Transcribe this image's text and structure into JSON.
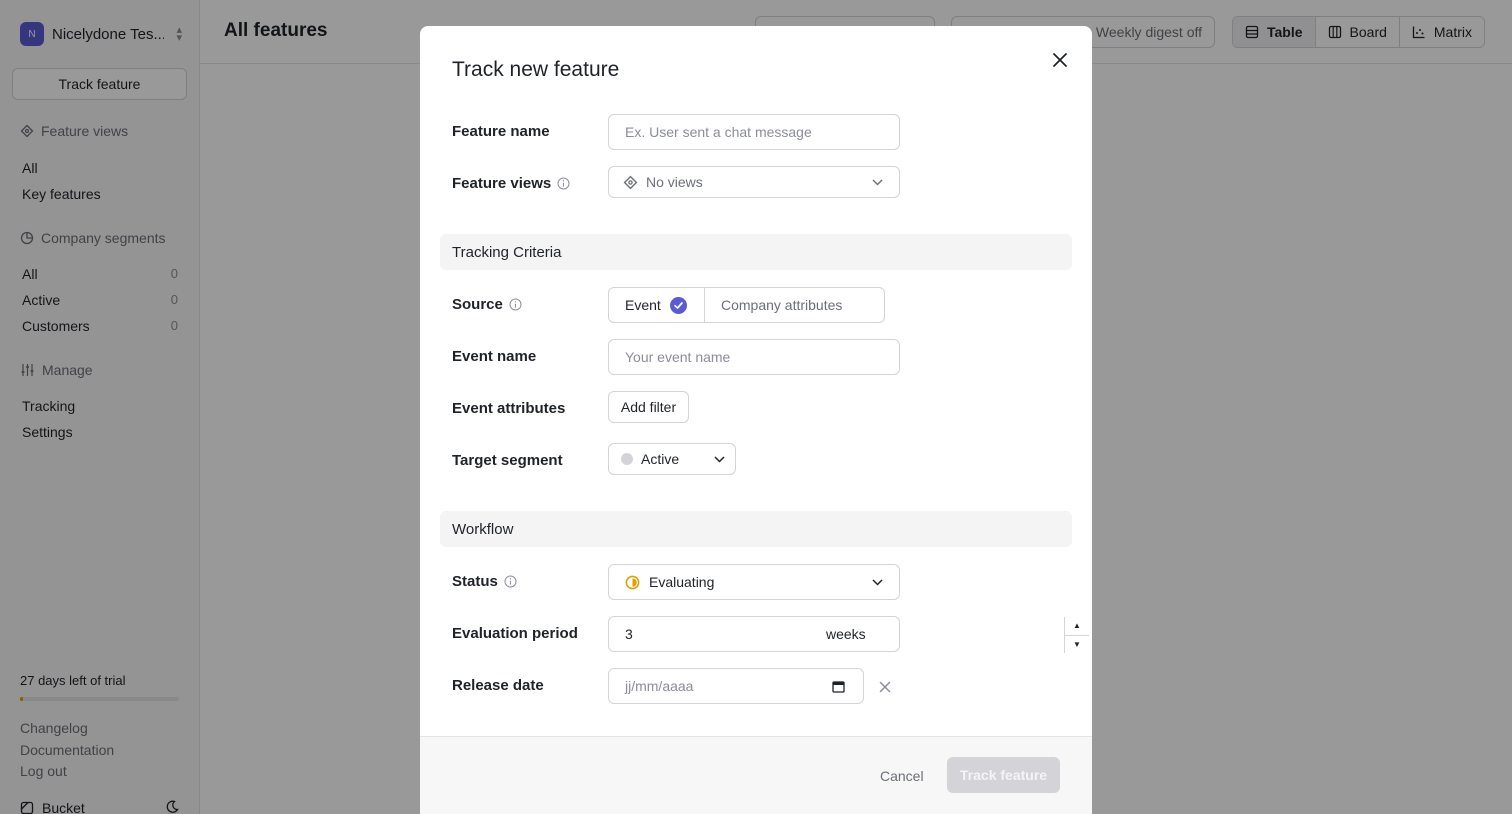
{
  "sidebar": {
    "org_initial": "N",
    "org_name": "Nicelydone Tes...",
    "track_button": "Track feature",
    "feature_views": {
      "heading": "Feature views",
      "items": [
        "All",
        "Key features"
      ]
    },
    "company_segments": {
      "heading": "Company segments",
      "items": [
        {
          "label": "All",
          "count": "0"
        },
        {
          "label": "Active",
          "count": "0"
        },
        {
          "label": "Customers",
          "count": "0"
        }
      ]
    },
    "manage": {
      "heading": "Manage",
      "items": [
        "Tracking",
        "Settings"
      ]
    },
    "trial_text": "27 days left of trial",
    "trial_progress_fraction": 0.02,
    "footer_links": [
      "Changelog",
      "Documentation",
      "Log out"
    ],
    "brand": "Bucket"
  },
  "header": {
    "title": "All features",
    "digest": "Weekly digest off",
    "views": [
      "Table",
      "Board",
      "Matrix"
    ],
    "active_view": "Table"
  },
  "modal": {
    "title": "Track new feature",
    "feature_name": {
      "label": "Feature name",
      "placeholder": "Ex. User sent a chat message",
      "value": ""
    },
    "feature_views": {
      "label": "Feature views",
      "value": "No views"
    },
    "tracking_section": "Tracking Criteria",
    "source": {
      "label": "Source",
      "options": [
        "Event",
        "Company attributes"
      ],
      "selected": "Event"
    },
    "event_name": {
      "label": "Event name",
      "placeholder": "Your event name",
      "value": ""
    },
    "event_attributes": {
      "label": "Event attributes",
      "button": "Add filter"
    },
    "target_segment": {
      "label": "Target segment",
      "value": "Active"
    },
    "workflow_section": "Workflow",
    "status": {
      "label": "Status",
      "value": "Evaluating"
    },
    "evaluation_period": {
      "label": "Evaluation period",
      "value": "3",
      "unit": "weeks"
    },
    "release_date": {
      "label": "Release date",
      "placeholder": "jj/mm/aaaa"
    },
    "cancel": "Cancel",
    "submit": "Track feature"
  },
  "colors": {
    "accent": "#5b5bd6",
    "status_evaluating": "#e0a100",
    "overlay": "rgba(0,0,0,0.40)"
  }
}
